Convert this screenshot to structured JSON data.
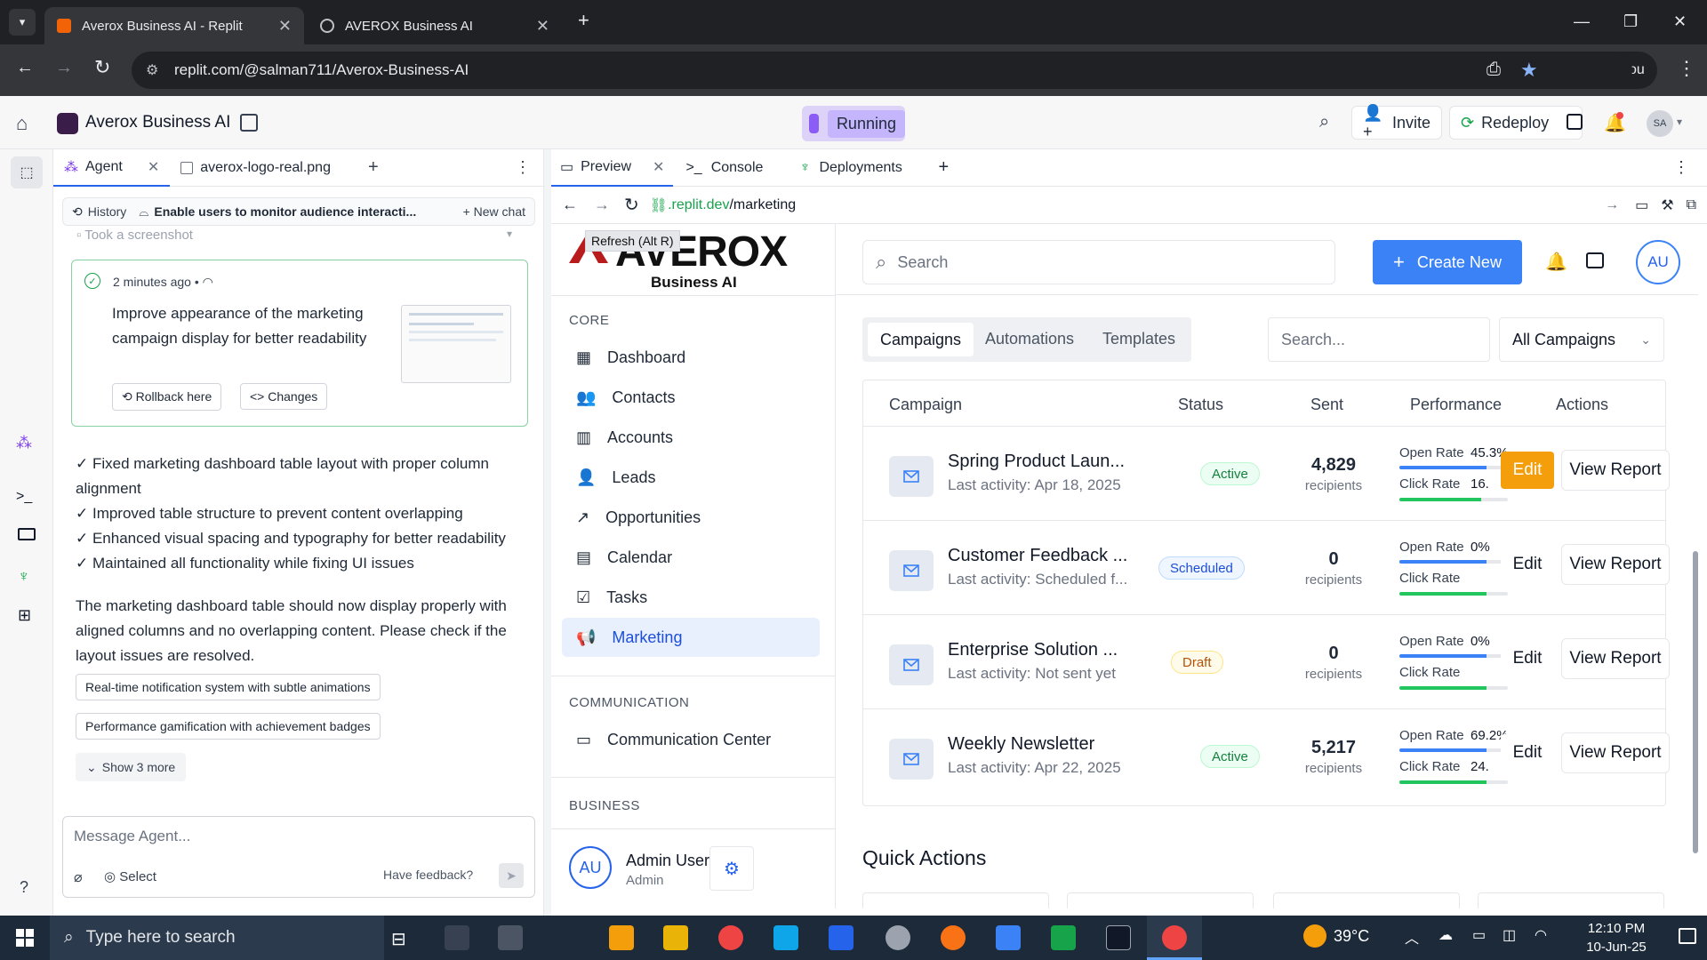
{
  "browser": {
    "tabs": [
      {
        "title": "Averox Business AI - Replit"
      },
      {
        "title": "AVEROX Business AI"
      }
    ],
    "url": "replit.com/@salman711/Averox-Business-AI",
    "verify_label": "Verify it's you"
  },
  "replit": {
    "project_name": "Averox Business AI",
    "status": "Running",
    "invite_label": "Invite",
    "redeploy_label": "Redeploy",
    "avatar_initials": "SA"
  },
  "agent": {
    "tabs": [
      {
        "label": "Agent"
      },
      {
        "label": "averox-logo-real.png"
      }
    ],
    "history_label": "History",
    "thread_title": "Enable users to monitor audience interacti...",
    "new_chat_label": "New chat",
    "screenshot_note": "Took a screenshot",
    "checkpoint": {
      "time": "2 minutes ago",
      "title": "Improve appearance of the marketing campaign display for better readability",
      "rollback_label": "Rollback here",
      "changes_label": "Changes"
    },
    "message_lines": [
      "✓ Fixed marketing dashboard table layout with proper column alignment",
      "✓ Improved table structure to prevent content overlapping",
      "✓ Enhanced visual spacing and typography for better readability",
      "✓ Maintained all functionality while fixing UI issues"
    ],
    "summary": "The marketing dashboard table should now display properly with aligned columns and no overlapping content. Please check if the layout issues are resolved.",
    "suggestions": [
      "Real-time notification system with subtle animations",
      "Performance gamification with achievement badges"
    ],
    "show_more_label": "Show 3 more",
    "input_placeholder": "Message Agent...",
    "select_label": "Select",
    "feedback_label": "Have feedback?"
  },
  "preview": {
    "tabs": [
      {
        "label": "Preview"
      },
      {
        "label": "Console"
      },
      {
        "label": "Deployments"
      }
    ],
    "url_prefix": ".replit.dev",
    "url_path": "/marketing",
    "tooltip": "Refresh (Alt R)"
  },
  "app": {
    "logo_text": "AVEROX",
    "logo_sub": "Business AI",
    "search_placeholder": "Search",
    "create_label": "Create New",
    "avatar_initials": "AU",
    "sections": {
      "core": "CORE",
      "communication": "COMMUNICATION",
      "business": "BUSINESS"
    },
    "nav_core": [
      {
        "label": "Dashboard",
        "icon": "dashboard-icon"
      },
      {
        "label": "Contacts",
        "icon": "contacts-icon"
      },
      {
        "label": "Accounts",
        "icon": "accounts-icon"
      },
      {
        "label": "Leads",
        "icon": "leads-icon"
      },
      {
        "label": "Opportunities",
        "icon": "trend-icon"
      },
      {
        "label": "Calendar",
        "icon": "calendar-icon"
      },
      {
        "label": "Tasks",
        "icon": "tasks-icon"
      },
      {
        "label": "Marketing",
        "icon": "megaphone-icon",
        "selected": true
      }
    ],
    "nav_comm": [
      {
        "label": "Communication Center",
        "icon": "chat-icon"
      }
    ],
    "user": {
      "initials": "AU",
      "name": "Admin User",
      "role": "Admin"
    },
    "tabs": [
      {
        "label": "Campaigns"
      },
      {
        "label": "Automations"
      },
      {
        "label": "Templates"
      }
    ],
    "filter_placeholder": "Search...",
    "filter_select": "All Campaigns",
    "columns": [
      "Campaign",
      "Status",
      "Sent",
      "Performance",
      "Actions"
    ],
    "open_rate_label": "Open Rate",
    "click_rate_label": "Click Rate",
    "edit_label": "Edit",
    "view_report_label": "View Report",
    "campaigns": [
      {
        "name": "Spring Product Laun...",
        "activity": "Last activity: Apr 18, 2025",
        "status": "Active",
        "sent": "4,829",
        "unit": "recipients",
        "open_rate": "45.3%",
        "click_rate": "16.",
        "open_frac": 0.8,
        "click_frac": 0.75
      },
      {
        "name": "Customer Feedback ...",
        "activity": "Last activity: Scheduled f...",
        "status": "Scheduled",
        "sent": "0",
        "unit": "recipients",
        "open_rate": "0%",
        "click_rate": "",
        "open_frac": 0.8,
        "click_frac": 0.8
      },
      {
        "name": "Enterprise Solution ...",
        "activity": "Last activity: Not sent yet",
        "status": "Draft",
        "sent": "0",
        "unit": "recipients",
        "open_rate": "0%",
        "click_rate": "",
        "open_frac": 0.8,
        "click_frac": 0.8
      },
      {
        "name": "Weekly Newsletter",
        "activity": "Last activity: Apr 22, 2025",
        "status": "Active",
        "sent": "5,217",
        "unit": "recipients",
        "open_rate": "69.2%",
        "click_rate": "24.",
        "open_frac": 0.8,
        "click_frac": 0.8
      }
    ],
    "quick_actions": "Quick Actions"
  },
  "taskbar": {
    "search_placeholder": "Type here to search",
    "temperature": "39°C",
    "time": "12:10 PM",
    "date": "10-Jun-25"
  }
}
